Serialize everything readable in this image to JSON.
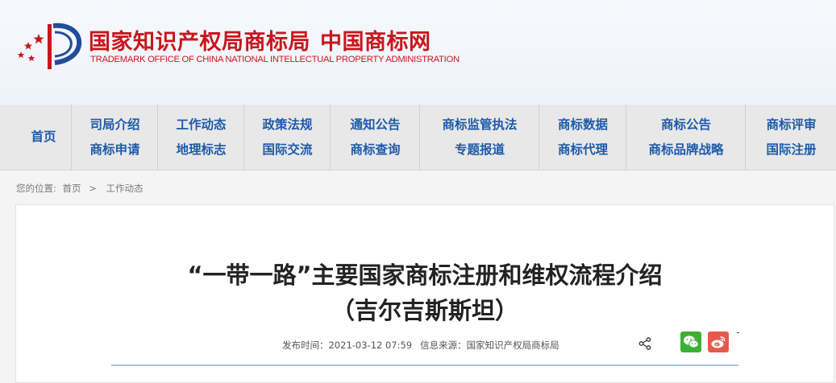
{
  "header": {
    "title_part1": "国家知识产权局商标局",
    "title_part2": "中国商标网",
    "subtitle": "TRADEMARK OFFICE OF CHINA NATIONAL INTELLECTUAL PROPERTY ADMINISTRATION"
  },
  "nav": {
    "home": "首页",
    "columns": [
      {
        "top": "司局介绍",
        "bottom": "商标申请"
      },
      {
        "top": "工作动态",
        "bottom": "地理标志"
      },
      {
        "top": "政策法规",
        "bottom": "国际交流"
      },
      {
        "top": "通知公告",
        "bottom": "商标查询"
      },
      {
        "top": "商标监管执法",
        "bottom": "专题报道"
      },
      {
        "top": "商标数据",
        "bottom": "商标代理"
      },
      {
        "top": "商标公告",
        "bottom": "商标品牌战略"
      },
      {
        "top": "商标评审",
        "bottom": "国际注册"
      }
    ]
  },
  "breadcrumb": {
    "prefix": "您的位置:",
    "home": "首页",
    "separator": ">",
    "current": "工作动态"
  },
  "article": {
    "title_line1": "“一带一路”主要国家商标注册和维权流程介绍",
    "title_line2": "（吉尔吉斯斯坦）",
    "publish_label": "发布时间：2021-03-12 07:59",
    "source_label": "信息来源：国家知识产权局商标局"
  },
  "colors": {
    "brand_red": "#c8161d",
    "nav_blue": "#1d5aa8",
    "wechat_green": "#3cb034",
    "weibo_red": "#e8594b"
  },
  "icons": [
    "cnipa-logo-icon",
    "share-icon",
    "wechat-icon",
    "weibo-icon"
  ]
}
